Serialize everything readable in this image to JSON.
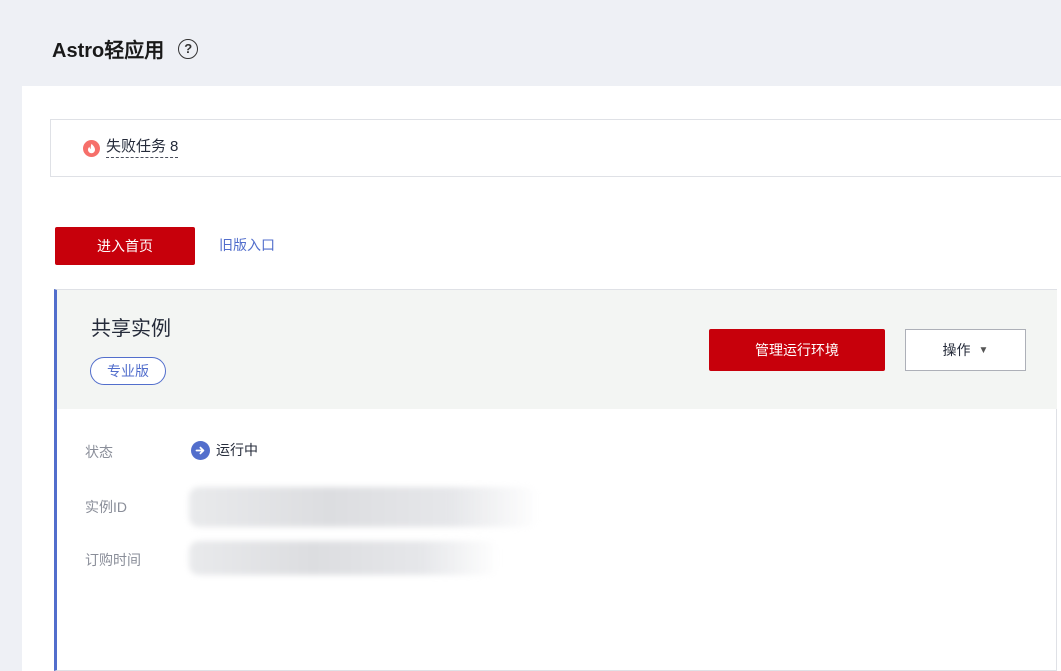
{
  "page": {
    "title": "Astro轻应用",
    "help_icon": "help-circle-icon"
  },
  "alert": {
    "icon": "fire-icon",
    "label": "失败任务",
    "count": "8"
  },
  "actions": {
    "enter_home": "进入首页",
    "old_entry": "旧版入口"
  },
  "instance": {
    "title": "共享实例",
    "edition": "专业版",
    "manage_env": "管理运行环境",
    "ops": "操作",
    "fields": {
      "status_label": "状态",
      "status_value": "运行中",
      "status_icon": "arrow-right-circle-icon",
      "id_label": "实例ID",
      "order_time_label": "订购时间"
    }
  },
  "colors": {
    "brand_red": "#c7000b",
    "accent_blue": "#526ecc",
    "alert_red": "#f66f6a"
  }
}
